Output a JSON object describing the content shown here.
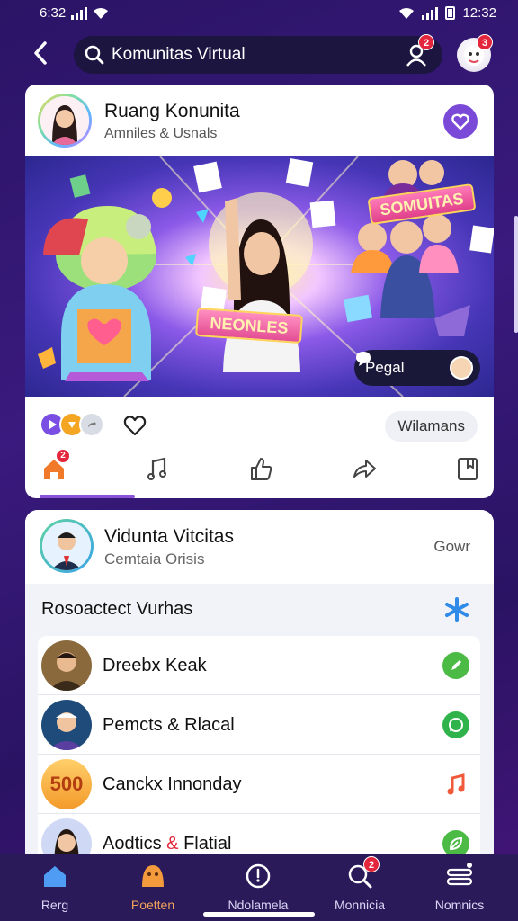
{
  "status_bar": {
    "time_left": "6:32",
    "time_right": "12:32"
  },
  "header": {
    "search_placeholder": "Komunitas Virtual",
    "search_badge": "2",
    "avatar_badge": "3"
  },
  "community": {
    "title": "Ruang Konunita",
    "subtitle": "Amniles & Usnals"
  },
  "banner": {
    "tag_right": "SOMUITAS",
    "tag_center": "NEONLES",
    "people_button": "Pegal"
  },
  "actions": {
    "members_chip": "Wilamans",
    "tab_badge": "2"
  },
  "member_header": {
    "name": "Vidunta Vitcitas",
    "subtitle": "Cemtaia Orisis",
    "action": "Gowr"
  },
  "section": {
    "title": "Rosoactect Vurhas"
  },
  "members": [
    {
      "name": "Dreebx Keak",
      "action_icon": "green-edit-icon"
    },
    {
      "name": "Pemcts & Rlacal",
      "action_icon": "whatsapp-icon"
    },
    {
      "name": "Canckx Innonday",
      "action_icon": "music-note-icon",
      "avatar_text": "500"
    },
    {
      "name": "Aodtics",
      "name_amp": "&",
      "name_tail": "Flatial",
      "action_icon": "leaf-icon"
    }
  ],
  "bottom_nav": {
    "items": [
      {
        "label": "Rerg"
      },
      {
        "label": "Poetten"
      },
      {
        "label": "Ndolamela"
      },
      {
        "label": "Monnicia",
        "badge": "2"
      },
      {
        "label": "Nomnics"
      }
    ]
  },
  "colors": {
    "accent": "#8a52d6",
    "badge": "#e3263b",
    "nav_bg": "#2a1a5a",
    "whatsapp_green": "#2fb34a"
  }
}
